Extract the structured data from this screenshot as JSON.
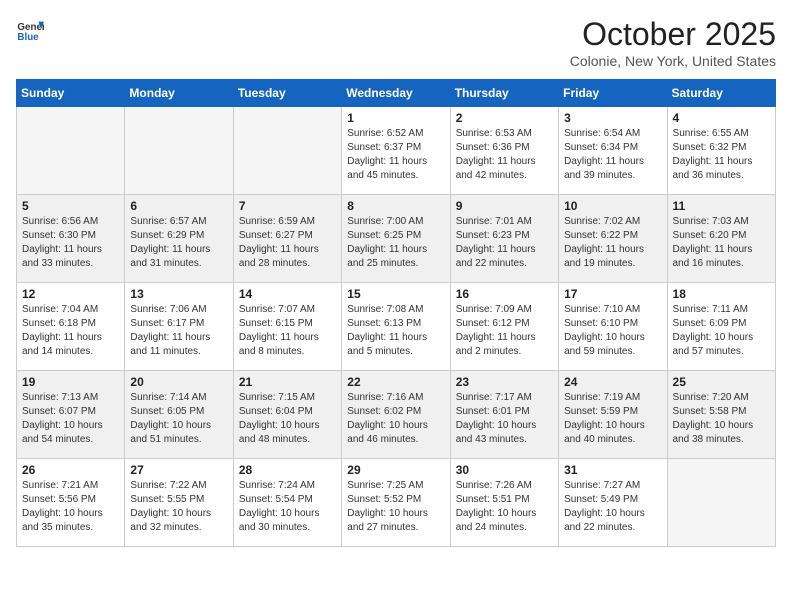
{
  "logo": {
    "general": "General",
    "blue": "Blue"
  },
  "header": {
    "month": "October 2025",
    "location": "Colonie, New York, United States"
  },
  "weekdays": [
    "Sunday",
    "Monday",
    "Tuesday",
    "Wednesday",
    "Thursday",
    "Friday",
    "Saturday"
  ],
  "weeks": [
    [
      {
        "day": "",
        "sunrise": "",
        "sunset": "",
        "daylight": "",
        "empty": true
      },
      {
        "day": "",
        "sunrise": "",
        "sunset": "",
        "daylight": "",
        "empty": true
      },
      {
        "day": "",
        "sunrise": "",
        "sunset": "",
        "daylight": "",
        "empty": true
      },
      {
        "day": "1",
        "sunrise": "Sunrise: 6:52 AM",
        "sunset": "Sunset: 6:37 PM",
        "daylight": "Daylight: 11 hours and 45 minutes.",
        "empty": false
      },
      {
        "day": "2",
        "sunrise": "Sunrise: 6:53 AM",
        "sunset": "Sunset: 6:36 PM",
        "daylight": "Daylight: 11 hours and 42 minutes.",
        "empty": false
      },
      {
        "day": "3",
        "sunrise": "Sunrise: 6:54 AM",
        "sunset": "Sunset: 6:34 PM",
        "daylight": "Daylight: 11 hours and 39 minutes.",
        "empty": false
      },
      {
        "day": "4",
        "sunrise": "Sunrise: 6:55 AM",
        "sunset": "Sunset: 6:32 PM",
        "daylight": "Daylight: 11 hours and 36 minutes.",
        "empty": false
      }
    ],
    [
      {
        "day": "5",
        "sunrise": "Sunrise: 6:56 AM",
        "sunset": "Sunset: 6:30 PM",
        "daylight": "Daylight: 11 hours and 33 minutes.",
        "empty": false
      },
      {
        "day": "6",
        "sunrise": "Sunrise: 6:57 AM",
        "sunset": "Sunset: 6:29 PM",
        "daylight": "Daylight: 11 hours and 31 minutes.",
        "empty": false
      },
      {
        "day": "7",
        "sunrise": "Sunrise: 6:59 AM",
        "sunset": "Sunset: 6:27 PM",
        "daylight": "Daylight: 11 hours and 28 minutes.",
        "empty": false
      },
      {
        "day": "8",
        "sunrise": "Sunrise: 7:00 AM",
        "sunset": "Sunset: 6:25 PM",
        "daylight": "Daylight: 11 hours and 25 minutes.",
        "empty": false
      },
      {
        "day": "9",
        "sunrise": "Sunrise: 7:01 AM",
        "sunset": "Sunset: 6:23 PM",
        "daylight": "Daylight: 11 hours and 22 minutes.",
        "empty": false
      },
      {
        "day": "10",
        "sunrise": "Sunrise: 7:02 AM",
        "sunset": "Sunset: 6:22 PM",
        "daylight": "Daylight: 11 hours and 19 minutes.",
        "empty": false
      },
      {
        "day": "11",
        "sunrise": "Sunrise: 7:03 AM",
        "sunset": "Sunset: 6:20 PM",
        "daylight": "Daylight: 11 hours and 16 minutes.",
        "empty": false
      }
    ],
    [
      {
        "day": "12",
        "sunrise": "Sunrise: 7:04 AM",
        "sunset": "Sunset: 6:18 PM",
        "daylight": "Daylight: 11 hours and 14 minutes.",
        "empty": false
      },
      {
        "day": "13",
        "sunrise": "Sunrise: 7:06 AM",
        "sunset": "Sunset: 6:17 PM",
        "daylight": "Daylight: 11 hours and 11 minutes.",
        "empty": false
      },
      {
        "day": "14",
        "sunrise": "Sunrise: 7:07 AM",
        "sunset": "Sunset: 6:15 PM",
        "daylight": "Daylight: 11 hours and 8 minutes.",
        "empty": false
      },
      {
        "day": "15",
        "sunrise": "Sunrise: 7:08 AM",
        "sunset": "Sunset: 6:13 PM",
        "daylight": "Daylight: 11 hours and 5 minutes.",
        "empty": false
      },
      {
        "day": "16",
        "sunrise": "Sunrise: 7:09 AM",
        "sunset": "Sunset: 6:12 PM",
        "daylight": "Daylight: 11 hours and 2 minutes.",
        "empty": false
      },
      {
        "day": "17",
        "sunrise": "Sunrise: 7:10 AM",
        "sunset": "Sunset: 6:10 PM",
        "daylight": "Daylight: 10 hours and 59 minutes.",
        "empty": false
      },
      {
        "day": "18",
        "sunrise": "Sunrise: 7:11 AM",
        "sunset": "Sunset: 6:09 PM",
        "daylight": "Daylight: 10 hours and 57 minutes.",
        "empty": false
      }
    ],
    [
      {
        "day": "19",
        "sunrise": "Sunrise: 7:13 AM",
        "sunset": "Sunset: 6:07 PM",
        "daylight": "Daylight: 10 hours and 54 minutes.",
        "empty": false
      },
      {
        "day": "20",
        "sunrise": "Sunrise: 7:14 AM",
        "sunset": "Sunset: 6:05 PM",
        "daylight": "Daylight: 10 hours and 51 minutes.",
        "empty": false
      },
      {
        "day": "21",
        "sunrise": "Sunrise: 7:15 AM",
        "sunset": "Sunset: 6:04 PM",
        "daylight": "Daylight: 10 hours and 48 minutes.",
        "empty": false
      },
      {
        "day": "22",
        "sunrise": "Sunrise: 7:16 AM",
        "sunset": "Sunset: 6:02 PM",
        "daylight": "Daylight: 10 hours and 46 minutes.",
        "empty": false
      },
      {
        "day": "23",
        "sunrise": "Sunrise: 7:17 AM",
        "sunset": "Sunset: 6:01 PM",
        "daylight": "Daylight: 10 hours and 43 minutes.",
        "empty": false
      },
      {
        "day": "24",
        "sunrise": "Sunrise: 7:19 AM",
        "sunset": "Sunset: 5:59 PM",
        "daylight": "Daylight: 10 hours and 40 minutes.",
        "empty": false
      },
      {
        "day": "25",
        "sunrise": "Sunrise: 7:20 AM",
        "sunset": "Sunset: 5:58 PM",
        "daylight": "Daylight: 10 hours and 38 minutes.",
        "empty": false
      }
    ],
    [
      {
        "day": "26",
        "sunrise": "Sunrise: 7:21 AM",
        "sunset": "Sunset: 5:56 PM",
        "daylight": "Daylight: 10 hours and 35 minutes.",
        "empty": false
      },
      {
        "day": "27",
        "sunrise": "Sunrise: 7:22 AM",
        "sunset": "Sunset: 5:55 PM",
        "daylight": "Daylight: 10 hours and 32 minutes.",
        "empty": false
      },
      {
        "day": "28",
        "sunrise": "Sunrise: 7:24 AM",
        "sunset": "Sunset: 5:54 PM",
        "daylight": "Daylight: 10 hours and 30 minutes.",
        "empty": false
      },
      {
        "day": "29",
        "sunrise": "Sunrise: 7:25 AM",
        "sunset": "Sunset: 5:52 PM",
        "daylight": "Daylight: 10 hours and 27 minutes.",
        "empty": false
      },
      {
        "day": "30",
        "sunrise": "Sunrise: 7:26 AM",
        "sunset": "Sunset: 5:51 PM",
        "daylight": "Daylight: 10 hours and 24 minutes.",
        "empty": false
      },
      {
        "day": "31",
        "sunrise": "Sunrise: 7:27 AM",
        "sunset": "Sunset: 5:49 PM",
        "daylight": "Daylight: 10 hours and 22 minutes.",
        "empty": false
      },
      {
        "day": "",
        "sunrise": "",
        "sunset": "",
        "daylight": "",
        "empty": true
      }
    ]
  ]
}
